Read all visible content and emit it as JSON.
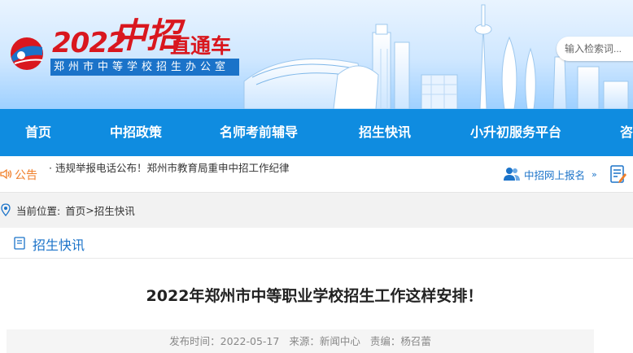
{
  "header": {
    "logo_year": "2022",
    "logo_main": "中招",
    "logo_suffix": "直通车",
    "logo_sub": "郑州市中等学校招生办公室",
    "search_placeholder": "输入检索词..."
  },
  "nav": {
    "items": [
      "首页",
      "中招政策",
      "名师考前辅导",
      "招生快讯",
      "小升初服务平台",
      "咨"
    ]
  },
  "notice": {
    "label": "公告",
    "text": "· 违规举报电话公布！郑州市教育局重申中招工作纪律",
    "register_link": "中招网上报名",
    "register_arrows": "»"
  },
  "breadcrumb": {
    "prefix": "当前位置:",
    "home": "首页",
    "sep": ">",
    "current": "招生快讯"
  },
  "section": {
    "title": "招生快讯"
  },
  "article": {
    "title": "2022年郑州市中等职业学校招生工作这样安排！",
    "publish_time": "发布时间：2022-05-17",
    "source": "来源：新闻中心",
    "editor": "责编：杨召蕾"
  },
  "colors": {
    "brand_red": "#d9171e",
    "nav_blue": "#0f8ce0",
    "link_blue": "#1b73c9",
    "notice_orange": "#f07f2a"
  }
}
